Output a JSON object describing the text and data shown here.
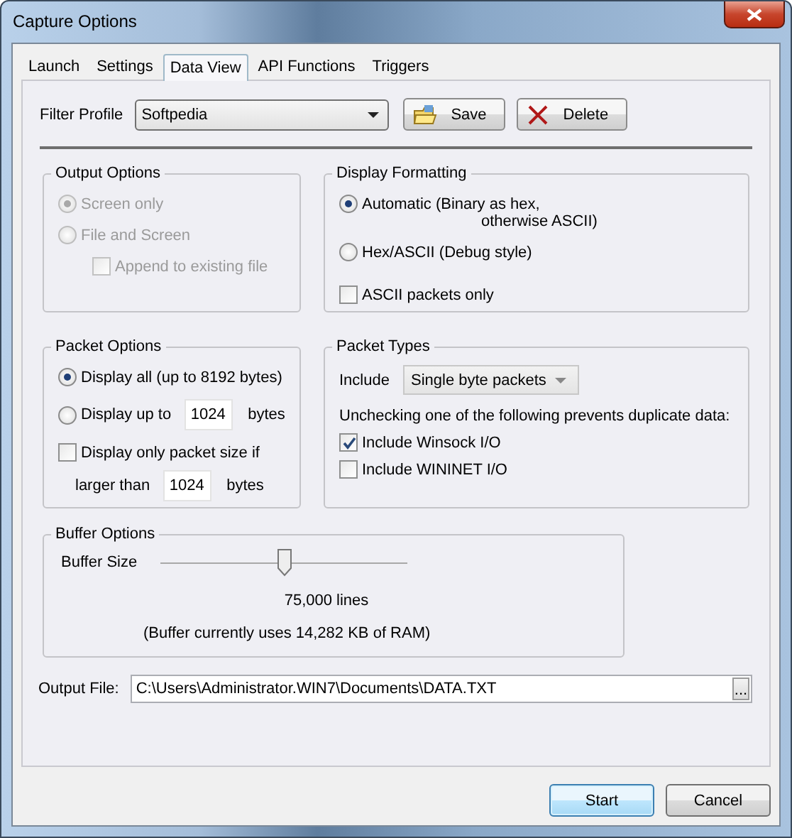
{
  "window": {
    "title": "Capture Options"
  },
  "tabs": [
    {
      "label": "Launch",
      "selected": false
    },
    {
      "label": "Settings",
      "selected": false
    },
    {
      "label": "Data View",
      "selected": true
    },
    {
      "label": "API Functions",
      "selected": false
    },
    {
      "label": "Triggers",
      "selected": false
    }
  ],
  "filter_profile": {
    "label": "Filter Profile",
    "value": "Softpedia",
    "buttons": [
      {
        "label": "Save",
        "kind": "save"
      },
      {
        "label": "Delete",
        "kind": "delete"
      }
    ]
  },
  "output_options": {
    "title": "Output Options",
    "disabled": true,
    "options": [
      {
        "kind": "radio",
        "label": "Screen only",
        "selected": true
      },
      {
        "kind": "radio",
        "label": "File and Screen",
        "selected": false
      },
      {
        "kind": "checkbox",
        "label": "Append to existing file",
        "checked": false,
        "indent": true
      }
    ]
  },
  "display_formatting": {
    "title": "Display Formatting",
    "disabled": false,
    "options": [
      {
        "kind": "radio",
        "label": "Automatic (Binary as hex,",
        "continuation": "otherwise ASCII)",
        "selected": true
      },
      {
        "kind": "radio",
        "label": "Hex/ASCII (Debug style)",
        "selected": false
      },
      {
        "kind": "checkbox",
        "label": "ASCII packets only",
        "checked": false
      }
    ]
  },
  "packet_options": {
    "title": "Packet Options",
    "disabled": false,
    "options": [
      {
        "kind": "radio",
        "label": "Display all (up to 8192 bytes)",
        "selected": true
      },
      {
        "kind": "radio",
        "label": "Display up to",
        "value": "1024",
        "suffix": "bytes",
        "selected": false
      },
      {
        "kind": "checkbox",
        "label": "Display only packet size if",
        "checked": false
      },
      {
        "kind": "field",
        "label": "larger than",
        "value": "1024",
        "suffix": "bytes"
      }
    ]
  },
  "packet_types": {
    "title": "Packet Types",
    "include_label": "Include",
    "include_value": "Single byte packets",
    "note": "Unchecking one of the following prevents duplicate data:",
    "options": [
      {
        "kind": "checkbox",
        "label": "Include Winsock I/O",
        "checked": true
      },
      {
        "kind": "checkbox",
        "label": "Include WININET I/O",
        "checked": false
      }
    ]
  },
  "buffer_options": {
    "title": "Buffer Options",
    "label": "Buffer Size",
    "level": 0.5,
    "reading": "75,000 lines",
    "note": "(Buffer currently uses 14,282 KB of RAM)"
  },
  "output_file": {
    "label": "Output File:",
    "value": "C:\\Users\\Administrator.WIN7\\Documents\\DATA.TXT",
    "browse": "..."
  },
  "buttons": [
    {
      "label": "Start",
      "default": true
    },
    {
      "label": "Cancel",
      "default": false
    }
  ]
}
